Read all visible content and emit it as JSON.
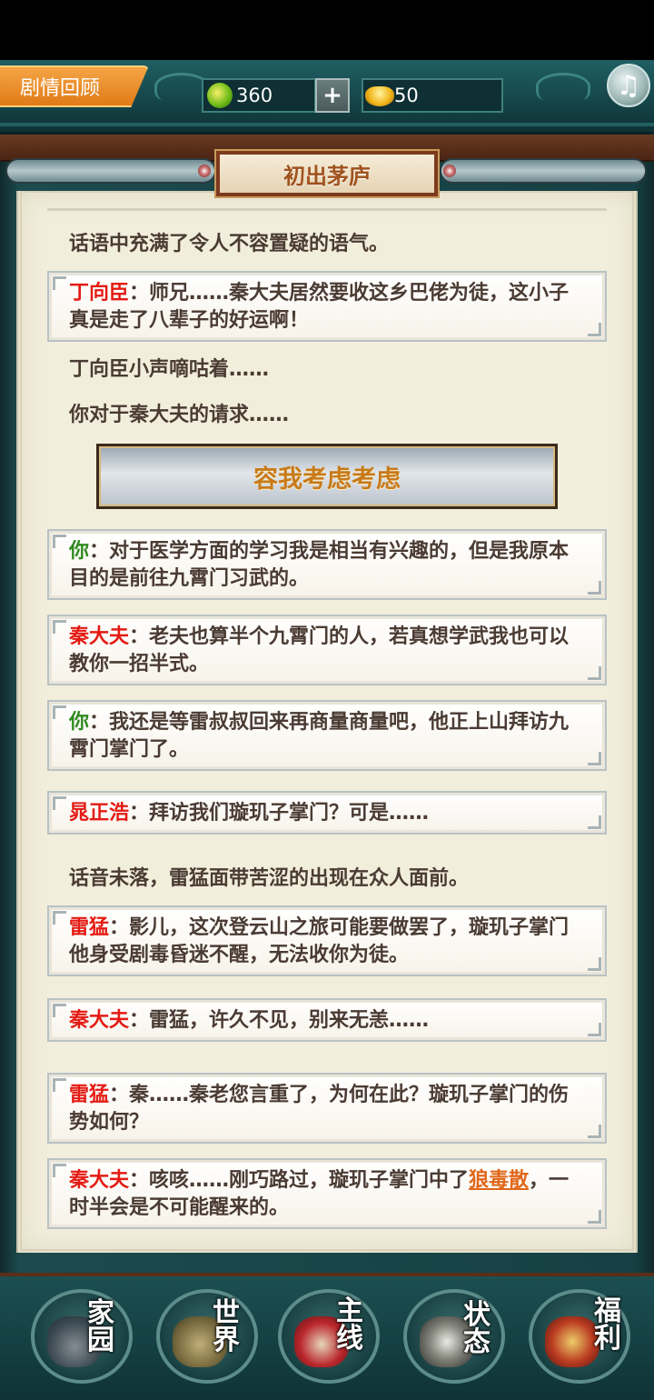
{
  "header": {
    "recap_label": "剧情回顾",
    "jade_amount": "360",
    "plus_label": "+",
    "gold_amount": "50",
    "music_icon": "♫"
  },
  "chapter": {
    "title": "初出茅庐"
  },
  "story": {
    "n1": "话语中充满了令人不容置疑的语气。",
    "d1_speaker": "丁向臣",
    "d1_text": "：师兄……秦大夫居然要收这乡巴佬为徒，这小子真是走了八辈子的好运啊！",
    "n2": "丁向臣小声嘀咕着……",
    "n3": "你对于秦大夫的请求……",
    "choice": "容我考虑考虑",
    "d2_speaker": "你",
    "d2_text": "：对于医学方面的学习我是相当有兴趣的，但是我原本目的是前往九霄门习武的。",
    "d3_speaker": "秦大夫",
    "d3_text": "：老夫也算半个九霄门的人，若真想学武我也可以教你一招半式。",
    "d4_speaker": "你",
    "d4_text": "：我还是等雷叔叔回来再商量商量吧，他正上山拜访九霄门掌门了。",
    "d5_speaker": "晁正浩",
    "d5_text": "：拜访我们璇玑子掌门？可是……",
    "n4": "话音未落，雷猛面带苦涩的出现在众人面前。",
    "d6_speaker": "雷猛",
    "d6_text": "：影儿，这次登云山之旅可能要做罢了，璇玑子掌门他身受剧毒昏迷不醒，无法收你为徒。",
    "d7_speaker": "秦大夫",
    "d7_text": "：雷猛，许久不见，别来无恙……",
    "d8_speaker": "雷猛",
    "d8_text": "：秦……秦老您言重了，为何在此？璇玑子掌门的伤势如何？",
    "d9_speaker": "秦大夫",
    "d9_text_a": "：咳咳……刚巧路过，璇玑子掌门中了",
    "d9_link": "狼毒散",
    "d9_text_b": "，一时半会是不可能醒来的。"
  },
  "nav": [
    {
      "l1": "家",
      "l2": "园",
      "icon": "home-icon"
    },
    {
      "l1": "世",
      "l2": "界",
      "icon": "world-map-icon"
    },
    {
      "l1": "主",
      "l2": "线",
      "icon": "main-quest-icon"
    },
    {
      "l1": "状",
      "l2": "态",
      "icon": "status-bagua-icon"
    },
    {
      "l1": "福",
      "l2": "利",
      "icon": "welfare-gift-icon"
    }
  ],
  "colors": {
    "speaker_red": "#e41b14",
    "speaker_green": "#2f8a1e",
    "link_orange": "#e0671a",
    "paper": "#f2eedc",
    "frame_teal": "#1d4a4d"
  }
}
